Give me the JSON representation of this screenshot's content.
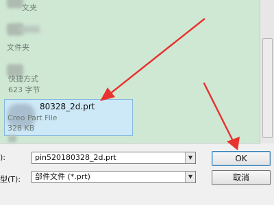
{
  "file_list": {
    "item1_partial_label": "文夹",
    "item2_label": "文件夹",
    "item3_label": "快捷方式",
    "item3_size": "623 字节",
    "selected_file": {
      "name": "80328_2d.prt",
      "type": "Creo Part File",
      "size": "328 KB"
    }
  },
  "form": {
    "filename_label": "):",
    "filename_value": "pin520180328_2d.prt",
    "filetype_label": "型(T):",
    "filetype_value": "部件文件 (*.prt)",
    "ok_label": "OK",
    "cancel_label": "取消"
  },
  "icons": {
    "dropdown": "▼"
  },
  "colors": {
    "pane_bg": "#cfe8d4",
    "selection_bg": "#cde8f7",
    "arrow": "#e8332f"
  }
}
